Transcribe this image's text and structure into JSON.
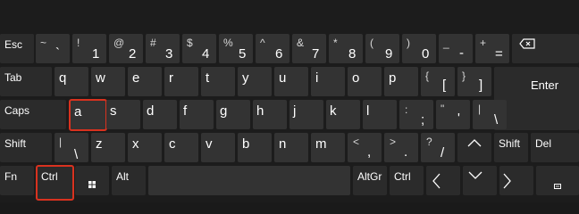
{
  "keys": {
    "esc": "Esc",
    "k1": {
      "top": "!",
      "main": "1"
    },
    "k2": {
      "top": "@",
      "main": "2"
    },
    "k3": {
      "top": "#",
      "main": "3"
    },
    "k4": {
      "top": "$",
      "main": "4"
    },
    "k5": {
      "top": "%",
      "main": "5"
    },
    "k6": {
      "top": "^",
      "main": "6"
    },
    "k7": {
      "top": "&",
      "main": "7"
    },
    "k8": {
      "top": "*",
      "main": "8"
    },
    "k9": {
      "top": "(",
      "main": "9"
    },
    "k0": {
      "top": ")",
      "main": "0"
    },
    "minus": {
      "top": "_",
      "main": "-"
    },
    "equal": {
      "top": "+",
      "main": "="
    },
    "tilde": {
      "top": "~",
      "main": "`"
    },
    "tab": "Tab",
    "q": "q",
    "w": "w",
    "e": "e",
    "r": "r",
    "t": "t",
    "y": "y",
    "u": "u",
    "i": "i",
    "o": "o",
    "p": "p",
    "lbracket": {
      "top": "{",
      "main": "["
    },
    "rbracket": {
      "top": "}",
      "main": "]"
    },
    "enter": "Enter",
    "caps": "Caps",
    "a": "a",
    "s": "s",
    "d": "d",
    "f": "f",
    "g": "g",
    "h": "h",
    "j": "j",
    "k": "k",
    "l": "l",
    "semicolon": {
      "top": ":",
      "main": ";"
    },
    "quote": {
      "top": "\"",
      "main": "'"
    },
    "backslash": {
      "top": "|",
      "main": "\\"
    },
    "shift_left": "Shift",
    "intl_backslash": {
      "top": "|",
      "main": "\\"
    },
    "z": "z",
    "x": "x",
    "c": "c",
    "v": "v",
    "b": "b",
    "n": "n",
    "m": "m",
    "comma": {
      "top": "<",
      "main": ","
    },
    "period": {
      "top": ">",
      "main": "."
    },
    "slash": {
      "top": "?",
      "main": "/"
    },
    "shift_right": "Shift",
    "del": "Del",
    "fn": "Fn",
    "ctrl_left": "Ctrl",
    "alt": "Alt",
    "altgr": "AltGr",
    "ctrl_right": "Ctrl"
  },
  "highlight_color": "#d9321f",
  "highlighted_keys": [
    "a",
    "ctrl_left"
  ]
}
